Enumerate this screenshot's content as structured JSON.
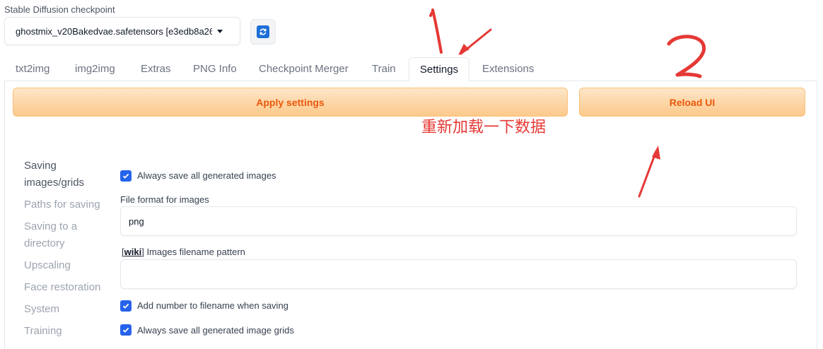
{
  "checkpoint": {
    "label": "Stable Diffusion checkpoint",
    "value": "ghostmix_v20Bakedvae.safetensors [e3edb8a26",
    "refresh_icon": "refresh-icon"
  },
  "tabs": [
    {
      "label": "txt2img"
    },
    {
      "label": "img2img"
    },
    {
      "label": "Extras"
    },
    {
      "label": "PNG Info"
    },
    {
      "label": "Checkpoint Merger"
    },
    {
      "label": "Train"
    },
    {
      "label": "Settings",
      "active": true
    },
    {
      "label": "Extensions"
    }
  ],
  "buttons": {
    "apply": "Apply settings",
    "reload": "Reload UI"
  },
  "settings_nav": [
    {
      "label": "Saving images/grids",
      "active": true
    },
    {
      "label": "Paths for saving"
    },
    {
      "label": "Saving to a directory"
    },
    {
      "label": "Upscaling"
    },
    {
      "label": "Face restoration"
    },
    {
      "label": "System"
    },
    {
      "label": "Training"
    }
  ],
  "settings": {
    "always_save_images": {
      "label": "Always save all generated images",
      "checked": true
    },
    "file_format": {
      "label": "File format for images",
      "value": "png"
    },
    "filename_pattern": {
      "wiki": "wiki",
      "label": " Images filename pattern",
      "value": ""
    },
    "add_number": {
      "label": "Add number to filename when saving",
      "checked": true
    },
    "always_save_grids": {
      "label": "Always save all generated image grids",
      "checked": true
    }
  },
  "annotations": {
    "marker_1": "1",
    "marker_2": "2",
    "note": "重新加载一下数据",
    "color": "#e53935"
  }
}
